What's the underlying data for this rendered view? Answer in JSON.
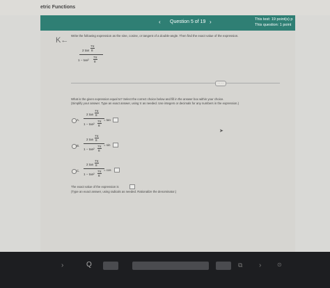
{
  "course": {
    "title": "etric Functions"
  },
  "header": {
    "prev": "‹",
    "question_counter": "Question 5 of 19",
    "next": "›",
    "test_points": "This test: 19 point(s) p",
    "question_points": "This question: 1 point"
  },
  "question": {
    "collapse_icon": "K←",
    "instruction": "Write the following expression as the sine, cosine, or tangent of a double-angle. Then find the exact value of the expression.",
    "expr_num": "2 tan",
    "expr_den": "1 − tan²",
    "angle_num": "7π",
    "angle_den": "8",
    "more_label": "· · · ·",
    "prompt_line1": "What is the given expression equal to? Select the correct choice below and fill in the answer box within your choice.",
    "prompt_line2": "(Simplify your answer. Type an exact answer, using π as needed. Use integers or decimals for any numbers in the expression.)"
  },
  "options": [
    {
      "letter": "A.",
      "func": "= tan"
    },
    {
      "letter": "B.",
      "func": "= sin"
    },
    {
      "letter": "C.",
      "func": "= cos"
    }
  ],
  "answer": {
    "text": "The exact value of the expression is",
    "hint": "(Type an exact answer, using radicals as needed. Rationalize the denominator.)"
  },
  "touchbar": {
    "escape_icon": "›",
    "search_icon": "Q"
  }
}
